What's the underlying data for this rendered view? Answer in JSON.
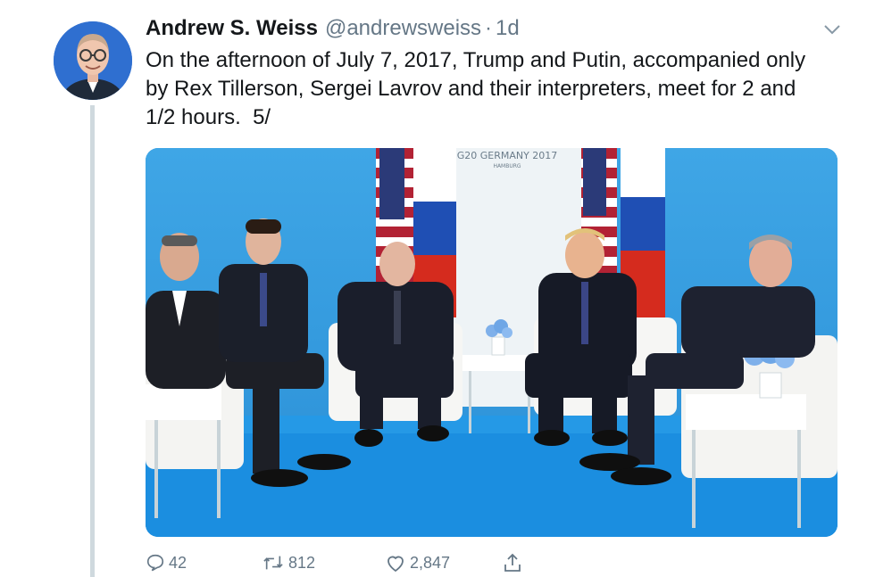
{
  "tweet": {
    "author_name": "Andrew S. Weiss",
    "handle": "@andrewsweiss",
    "separator": "·",
    "time": "1d",
    "text": "On the afternoon of July 7, 2017, Trump and Putin, accompanied only\nby Rex Tillerson, Sergei Lavrov and their interpreters, meet for 2 and\n1/2 hours.  5/"
  },
  "photo": {
    "banner_title": "G20 GERMANY 2017",
    "banner_subtitle": "HAMBURG"
  },
  "actions": {
    "replies": "42",
    "retweets": "812",
    "likes": "2,847"
  },
  "icons": [
    "chevron-down-icon",
    "reply-icon",
    "retweet-icon",
    "heart-icon",
    "share-icon"
  ],
  "colors": {
    "text": "#14171a",
    "secondary": "#657786",
    "thread_line": "#cfd9de",
    "backdrop_blue": "#2a8fd6",
    "carpet_blue": "#1b8ee0"
  }
}
